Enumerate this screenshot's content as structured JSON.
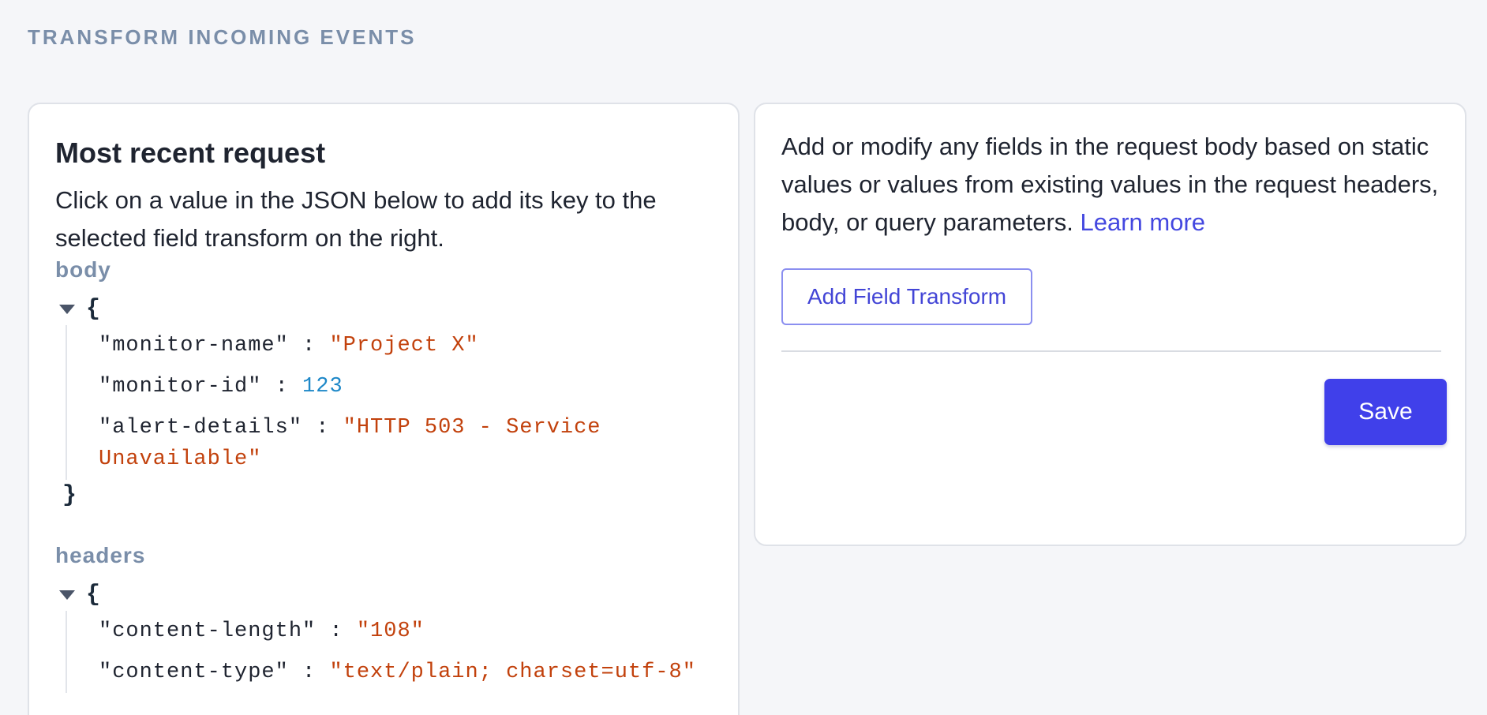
{
  "page": {
    "section_title": "TRANSFORM INCOMING EVENTS"
  },
  "left_card": {
    "heading": "Most recent request",
    "description": "Click on a value in the JSON below to add its key to the selected field transform on the right.",
    "body": {
      "label": "body",
      "open_brace": "{",
      "close_brace": "}",
      "fields": [
        {
          "key": "\"monitor-name\"",
          "value": "\"Project X\"",
          "type": "string"
        },
        {
          "key": "\"monitor-id\"",
          "value": "123",
          "type": "number"
        },
        {
          "key": "\"alert-details\"",
          "value": "\"HTTP 503 - Service Unavailable\"",
          "type": "string"
        }
      ]
    },
    "headers": {
      "label": "headers",
      "open_brace": "{",
      "fields": [
        {
          "key": "\"content-length\"",
          "value": "\"108\"",
          "type": "string"
        },
        {
          "key": "\"content-type\"",
          "value": "\"text/plain; charset=utf-8\"",
          "type": "string"
        }
      ]
    },
    "separator": ":"
  },
  "right_card": {
    "description": "Add or modify any fields in the request body based on static values or values from existing values in the request headers, body, or query parameters.",
    "learn_more": "Learn more",
    "add_button": "Add Field Transform",
    "save_button": "Save"
  },
  "colors": {
    "accent": "#4040ea",
    "string_value": "#c2410c",
    "number_value": "#1e88c8",
    "muted_label": "#7a8ea9"
  }
}
